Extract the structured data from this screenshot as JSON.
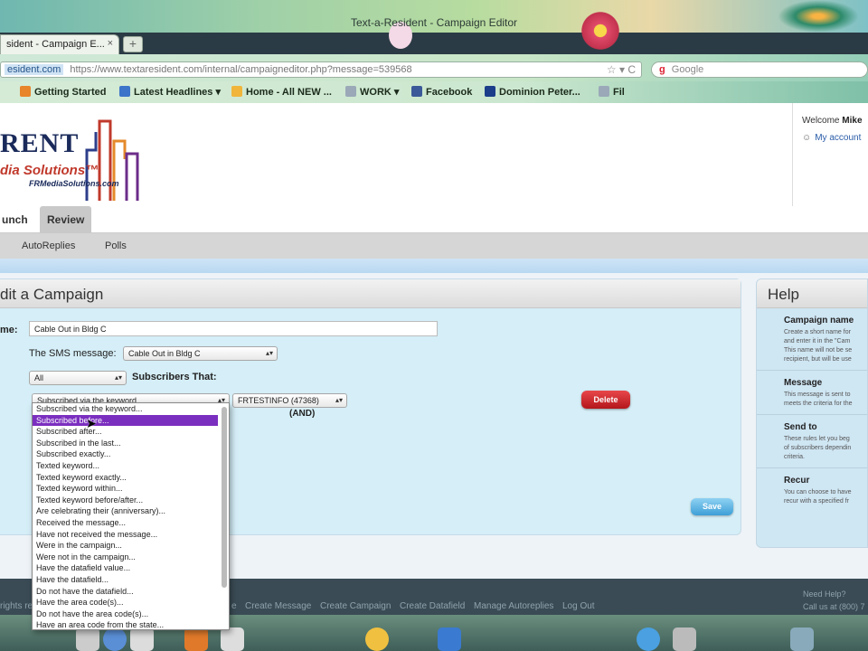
{
  "browser": {
    "window_title": "Text-a-Resident - Campaign Editor",
    "tab_title": "sident - Campaign E...",
    "tab_close": "×",
    "new_tab": "+",
    "url_host": "esident.com",
    "url": "https://www.textaresident.com/internal/campaigneditor.php?message=539568",
    "search_placeholder": "Google",
    "search_logo": "g",
    "url_controls": "☆ ▾ C",
    "bookmarks": [
      "Getting Started",
      "Latest Headlines ▾",
      "Home - All NEW ...",
      "WORK ▾",
      "Facebook",
      "Dominion Peter...",
      "Fil"
    ]
  },
  "header": {
    "logo_main": "RENT",
    "logo_sub": "dia Solutions™",
    "logo_url": "FRMediaSolutions.com",
    "welcome_text": "Welcome",
    "user_name": "Mike",
    "my_account": "My account"
  },
  "nav": {
    "tabs": [
      "unch",
      "Review"
    ],
    "subnav": [
      "AutoReplies",
      "Polls"
    ]
  },
  "campaign": {
    "heading": "dit a Campaign",
    "name_label": "me:",
    "name_value": "Cable Out in Bldg C",
    "sms_label": "The SMS message:",
    "sms_value": "Cable Out in Bldg C",
    "scope_value": "All",
    "subscribers_label": "Subscribers That:",
    "criteria_value": "Subscribed via the keyword...",
    "keyword_value": "FRTESTINFO (47368)",
    "and_label": "(AND)",
    "delete_label": "Delete",
    "save_label": "Save"
  },
  "dropdown": {
    "selected_index": 1,
    "options": [
      "Subscribed via the keyword...",
      "Subscribed before...",
      "Subscribed after...",
      "Subscribed in the last...",
      "Subscribed exactly...",
      "Texted keyword...",
      "Texted keyword exactly...",
      "Texted keyword within...",
      "Texted keyword before/after...",
      "Are celebrating their (anniversary)...",
      "Received the message...",
      "Have not received the message...",
      "Were in the campaign...",
      "Were not in the campaign...",
      "Have the datafield value...",
      "Have the datafield...",
      "Do not have the datafield...",
      "Have the area code(s)...",
      "Do not have the area code(s)...",
      "Have an area code from the state..."
    ]
  },
  "help": {
    "heading": "Help",
    "sections": [
      {
        "title": "Campaign name",
        "lines": [
          "Create a short name for",
          "and enter it in the \"Cam",
          "This name will not be se",
          "recipient, but will be use"
        ]
      },
      {
        "title": "Message",
        "lines": [
          "This message is sent to",
          "meets the criteria for the"
        ]
      },
      {
        "title": "Send to",
        "lines": [
          "These rules let you beg",
          "of subscribers dependin",
          "criteria."
        ]
      },
      {
        "title": "Recur",
        "lines": [
          "You can choose to have",
          "recur with a specified fr"
        ]
      }
    ]
  },
  "footer": {
    "links": [
      "e",
      "Create Message",
      "Create Campaign",
      "Create Datafield",
      "Manage Autoreplies",
      "Log Out"
    ],
    "left_text": "rights re",
    "help_line1": "Need Help?",
    "help_line2": "Call us at (800) 7"
  },
  "colors": {
    "dropdown_highlight": "#7b2fbf",
    "delete_button": "#c8232a",
    "save_button": "#55b0e0",
    "panel_bg": "#d5eef7"
  }
}
